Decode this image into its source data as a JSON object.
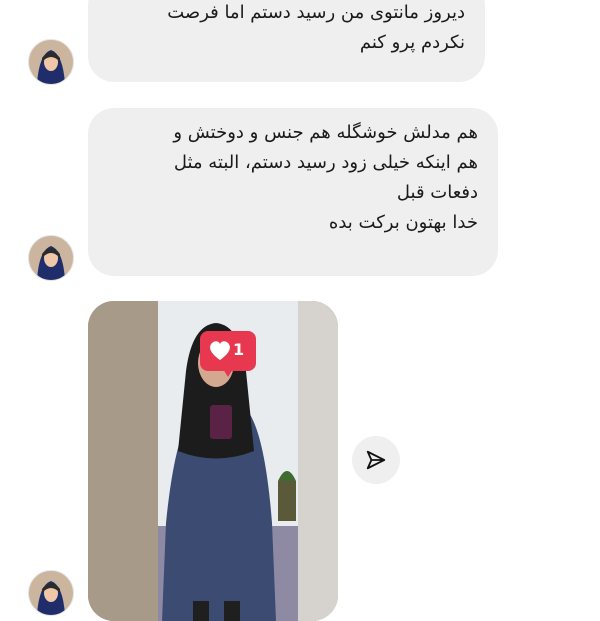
{
  "messages": [
    {
      "lines": [
        "دیروز مانتوی من رسید دستم اما فرصت",
        "نکردم پرو کنم"
      ]
    },
    {
      "lines": [
        "هم مدلش خوشگله هم جنس و دوختش و",
        "هم اینکه خیلی زود رسید دستم، البته مثل",
        "دفعات قبل",
        "خدا بهتون برکت بده"
      ]
    }
  ],
  "photo_message": {
    "like_count": "1",
    "like_icon": "heart-icon",
    "share_icon": "send-icon"
  },
  "colors": {
    "bubble": "#efefef",
    "like_badge": "#e8384f",
    "text": "#1a1a1a"
  }
}
